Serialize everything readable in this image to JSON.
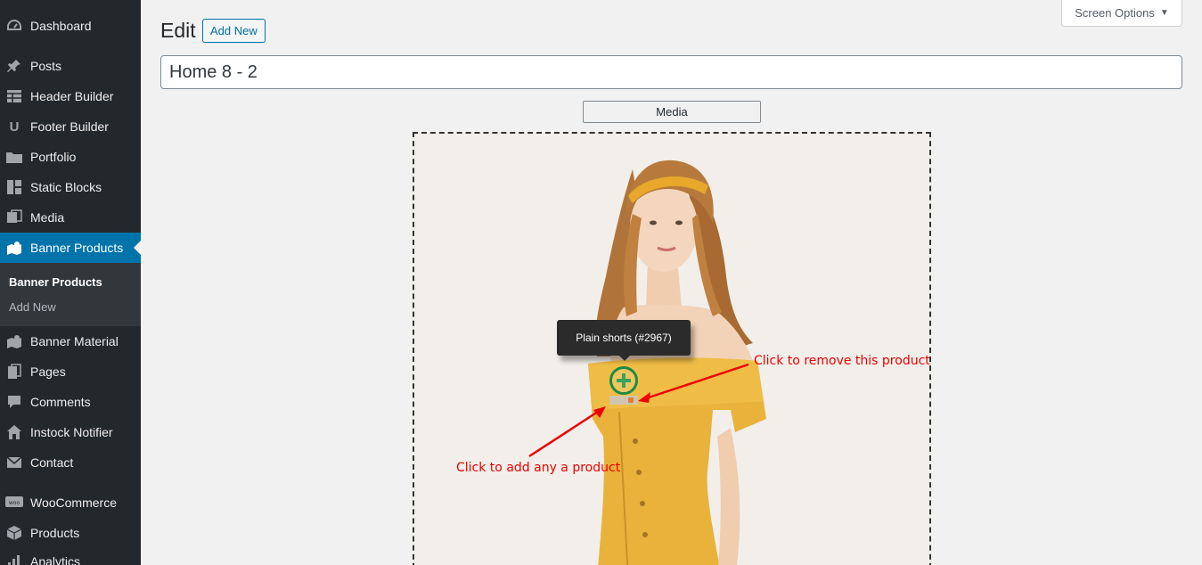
{
  "sidebar": {
    "items": [
      {
        "label": "Dashboard",
        "icon": "dashboard-icon"
      },
      {
        "label": "Posts",
        "icon": "pin-icon"
      },
      {
        "label": "Header Builder",
        "icon": "table-icon"
      },
      {
        "label": "Footer Builder",
        "icon": "underline-icon"
      },
      {
        "label": "Portfolio",
        "icon": "folder-icon"
      },
      {
        "label": "Static Blocks",
        "icon": "blocks-icon"
      },
      {
        "label": "Media",
        "icon": "media-icon"
      },
      {
        "label": "Banner Products",
        "icon": "map-icon"
      },
      {
        "label": "Banner Material",
        "icon": "map-icon"
      },
      {
        "label": "Pages",
        "icon": "pages-icon"
      },
      {
        "label": "Comments",
        "icon": "comment-icon"
      },
      {
        "label": "Instock Notifier",
        "icon": "home-icon"
      },
      {
        "label": "Contact",
        "icon": "mail-icon"
      },
      {
        "label": "WooCommerce",
        "icon": "woo-icon"
      },
      {
        "label": "Products",
        "icon": "box-icon"
      },
      {
        "label": "Analytics",
        "icon": "chart-icon"
      }
    ],
    "submenu": [
      "Banner Products",
      "Add New"
    ]
  },
  "header": {
    "title": "Edit",
    "add_new": "Add New",
    "screen_options": "Screen Options"
  },
  "post": {
    "title": "Home 8 - 2",
    "media_button": "Media"
  },
  "banner": {
    "tooltip": "Plain shorts (#2967)",
    "annotation_remove": "Click to remove this product",
    "annotation_add": "Click to add any a product"
  },
  "colors": {
    "sidebar_bg": "#23282d",
    "accent": "#0073aa",
    "dress": "#e9b23a",
    "annotation": "#e00000"
  }
}
